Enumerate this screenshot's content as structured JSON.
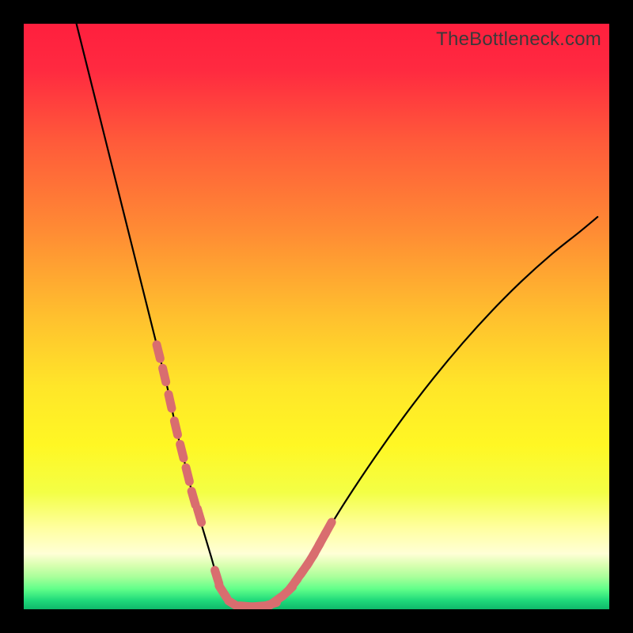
{
  "watermark": "TheBottleneck.com",
  "colors": {
    "frame": "#000000",
    "curve_stroke": "#000000",
    "marker_fill": "#d96d6f",
    "gradient_stops": [
      {
        "offset": 0.0,
        "color": "#ff1f3e"
      },
      {
        "offset": 0.08,
        "color": "#ff2a40"
      },
      {
        "offset": 0.2,
        "color": "#ff5a3a"
      },
      {
        "offset": 0.35,
        "color": "#ff8a34"
      },
      {
        "offset": 0.5,
        "color": "#ffc02e"
      },
      {
        "offset": 0.62,
        "color": "#ffe629"
      },
      {
        "offset": 0.72,
        "color": "#fff724"
      },
      {
        "offset": 0.8,
        "color": "#f3ff45"
      },
      {
        "offset": 0.86,
        "color": "#ffff9e"
      },
      {
        "offset": 0.905,
        "color": "#ffffd6"
      },
      {
        "offset": 0.925,
        "color": "#d8ffb0"
      },
      {
        "offset": 0.945,
        "color": "#a8ff9a"
      },
      {
        "offset": 0.965,
        "color": "#62ff8a"
      },
      {
        "offset": 0.985,
        "color": "#1fd97a"
      },
      {
        "offset": 1.0,
        "color": "#0fb86a"
      }
    ]
  },
  "chart_data": {
    "type": "line",
    "title": "",
    "xlabel": "",
    "ylabel": "",
    "xlim": [
      0,
      100
    ],
    "ylim": [
      0,
      100
    ],
    "grid": false,
    "series": [
      {
        "name": "bottleneck-curve",
        "x": [
          9,
          11,
          13,
          15,
          17,
          19,
          21,
          23,
          24.5,
          26,
          27.5,
          29,
          30.5,
          32,
          33,
          34,
          35,
          36,
          38,
          40,
          42,
          44,
          46,
          48,
          51,
          55,
          60,
          65,
          70,
          75,
          80,
          85,
          90,
          95,
          98
        ],
        "y": [
          100,
          92,
          84,
          76,
          68,
          60,
          52,
          44,
          38,
          31,
          25,
          19,
          14,
          9,
          5.5,
          3,
          1.5,
          0.8,
          0.5,
          0.5,
          0.8,
          2,
          4,
          7,
          12,
          18.5,
          26,
          33,
          39.5,
          45.5,
          51,
          56,
          60.5,
          64.5,
          67
        ]
      }
    ],
    "markers": {
      "name": "highlighted-points",
      "x": [
        23,
        24,
        25,
        26,
        27,
        28,
        29,
        30,
        33,
        34,
        36,
        38,
        40,
        42,
        43,
        45,
        46,
        47,
        48,
        49,
        50,
        51,
        52
      ],
      "y": [
        44,
        40,
        35.5,
        31,
        27,
        23,
        19,
        16,
        5.5,
        3,
        0.8,
        0.5,
        0.5,
        0.8,
        1.4,
        3,
        4.2,
        5.6,
        7,
        8.5,
        10.2,
        12,
        13.8
      ]
    }
  }
}
